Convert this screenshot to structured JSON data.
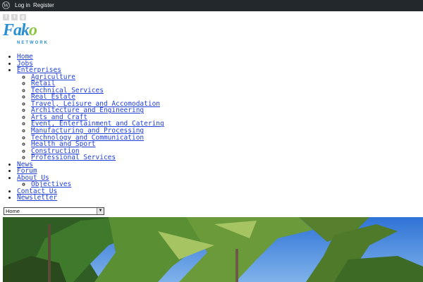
{
  "admin_bar": {
    "login": "Log in",
    "register": "Register"
  },
  "logo": {
    "brand_main": "Fak",
    "brand_accent": "o",
    "subtitle": "NETWORK"
  },
  "social": [
    "f",
    "t",
    "g"
  ],
  "menu": {
    "home": "Home",
    "jobs": "Jobs",
    "enterprises": "Enterprises",
    "enterprise_items": [
      "Agriculture",
      "Retail",
      "Technical Services",
      "Real Estate",
      "Travel, Leisure and Accomodation",
      "Architecture and Engineering",
      "Arts and Craft",
      "Event, Entertainment and Catering",
      "Manufacturing and Processing",
      "Technology and Communication",
      "Health and Sport",
      "Construction",
      "Professional Services"
    ],
    "news": "News",
    "forum": "Forum",
    "about": "About Us",
    "about_items": [
      "Objectives"
    ],
    "contact": "Contact Us",
    "newsletter": "Newsletter"
  },
  "nav_select": {
    "selected": "Home"
  },
  "colors": {
    "admin_bar": "#23282d",
    "link": "#1f3fd7",
    "logo_blue": "#2a8fd0",
    "logo_green": "#8cc63f",
    "sky": "#3f86dd"
  }
}
